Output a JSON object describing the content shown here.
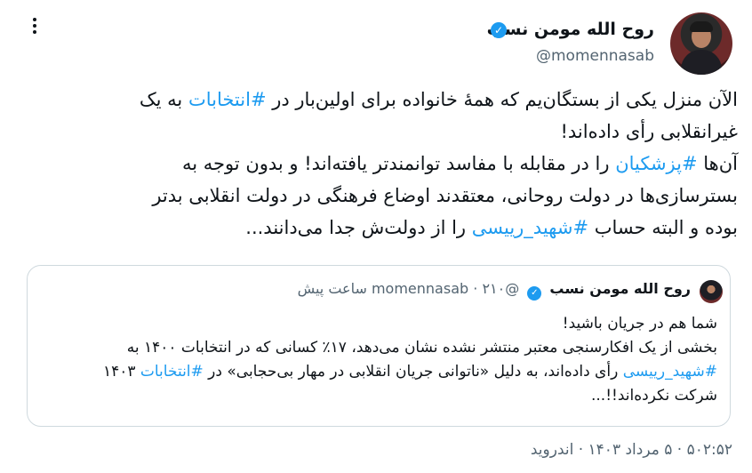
{
  "author": {
    "name": "روح الله مومن نسب",
    "handle": "@momennasab"
  },
  "tweet": {
    "line1_a": "الآن منزل یکی از بستگان‌یم که همهٔ خانواده برای اولین‌بار در ",
    "line1_tag": "#انتخابات",
    "line1_b": " به یک",
    "line2": "غیرانقلابی رأی داده‌اند!",
    "line3_a": "آن‌ها ",
    "line3_tag": "#پزشکیان",
    "line3_b": " را در مقابله با مفاسد توانمندتر یافته‌اند! و بدون توجه به",
    "line4": "بسترسازی‌ها در دولت روحانی، معتقدند اوضاع فرهنگی در دولت انقلابی بدتر",
    "line5_a": "بوده و البته حساب ",
    "line5_tag": "#شهید_رییسی",
    "line5_b": " را از دولت‌ش جدا می‌دانند..."
  },
  "quote": {
    "name": "روح الله مومن نسب",
    "handle": "@momennasab",
    "separator": "·",
    "time": "۲۱۰ ساعت پیش",
    "line1": "شما هم در جریان باشید!",
    "line2": "بخشی از یک افکارسنجی معتبر منتشر نشده نشان می‌دهد، ۱۷٪ کسانی که در انتخابات ۱۴۰۰ به",
    "line3_tag1": "#شهید_رییسی",
    "line3_mid": " رأی داده‌اند، به دلیل «ناتوانی جریان انقلابی در مهار بی‌حجابی» در ",
    "line3_tag2": "#انتخابات",
    "line3_end": " ۱۴۰۳",
    "line4": "شرکت نکرده‌اند!!..."
  },
  "timestamp": "۵۰۲:۵۲ · ۵ مرداد ۱۴۰۳ · اندروید",
  "colors": {
    "accent": "#1d9bf0",
    "text": "#0f1419",
    "muted": "#536471",
    "border": "#cfd9de"
  },
  "icons": [
    "verified-badge-icon",
    "more-options-icon"
  ]
}
